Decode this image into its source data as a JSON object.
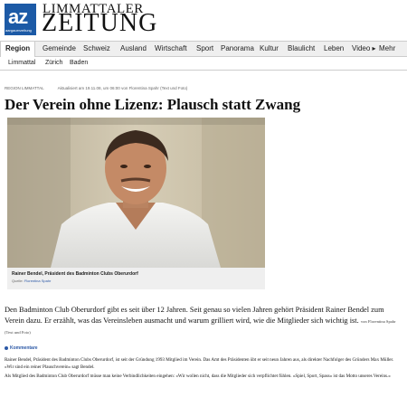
{
  "logo": {
    "mark": "az",
    "sub": "aargauerzeitung"
  },
  "brand": {
    "top": "LIMMATTALER",
    "main": "ZEITUNG"
  },
  "nav": {
    "items": [
      "Region",
      "Gemeinde",
      "Schweiz",
      "Ausland",
      "Wirtschaft",
      "Sport",
      "Panorama",
      "Kultur",
      "Blaulicht",
      "Leben",
      "Video ▸",
      "Mehr"
    ],
    "active": "Region"
  },
  "subnav": {
    "items": [
      "Limmattal",
      "Zürich",
      "Baden"
    ]
  },
  "article": {
    "section": "REGION LIMMATTAL",
    "meta": "Aktualisiert am 19.11.08, um 06:00 von Florentina Spahr (Text und Foto)",
    "title": "Der Verein ohne Lizenz: Plausch statt Zwang",
    "photo_caption": "Rainer Bendel, Präsident des Badminton Clubs Oberurdorf",
    "photo_credit_label": "Quelle:",
    "photo_credit_name": "Florentina Spahr",
    "lead": "Den Badminton Club Oberurdorf gibt es seit über 12 Jahren. Seit genau so vielen Jahren gehört Präsident Rainer Bendel zum Verein dazu. Er erzählt, was das Vereinsleben ausmacht und warum grilliert wird, wie die Mitglieder sich wichtig ist.",
    "lead_author": "von Florentina Spahr (Text und Foto)",
    "comments_label": "Kommentare",
    "paragraphs": [
      "Rainer Bendel, Präsident des Badminton Clubs Oberurdorf, ist seit der Gründung 1993 Mitglied im Verein. Das Amt des Präsidenten übt er seit neun Jahren aus, als direkter Nachfolger des Gründers Max Müller. «Wir sind ein reiner Plauschverein» sagt Bendel.",
      "Als Mitglied des Badminton Club Oberurdorf müsse man keine Verbindlichkeiten eingehen: «Wir wollen nicht, dass die Mitglieder sich verpflichtet fühlen. «Spiel, Sport, Spass» ist das Motto unseres Vereins.»"
    ]
  },
  "colors": {
    "accent": "#2b58a6",
    "logo_bg": "#1c5aa6",
    "nav_bg": "#efefef"
  }
}
